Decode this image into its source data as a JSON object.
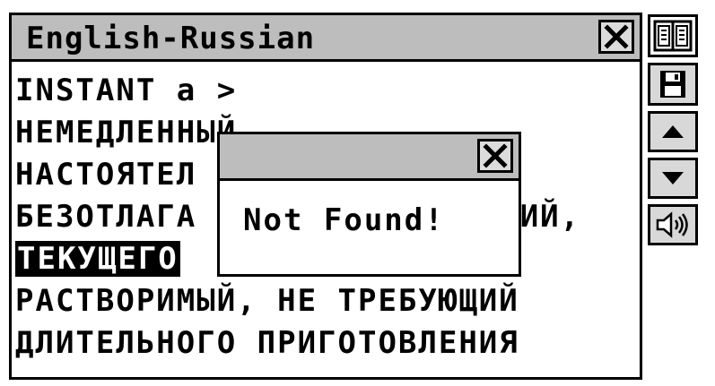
{
  "window": {
    "title": "English-Russian"
  },
  "entry": {
    "lines": [
      "INSTANT a >",
      "НЕМЕДЛЕННЫЙ",
      "НАСТОЯТЕЛ",
      "БЕЗОТЛАГА",
      "",
      "РАСТВОРИМЫЙ, НЕ ТРЕБУЮЩИЙ",
      "ДЛИТЕЛЬНОГО ПРИГОТОВЛЕНИЯ"
    ],
    "line3_tail": "ЩИЙ,",
    "highlighted_word": "ТЕКУЩЕГО"
  },
  "dialog": {
    "message": "Not Found!"
  },
  "toolbar": {
    "icons": [
      "book-icon",
      "floppy-disk-icon",
      "arrow-up-icon",
      "arrow-down-icon",
      "speaker-icon"
    ]
  }
}
